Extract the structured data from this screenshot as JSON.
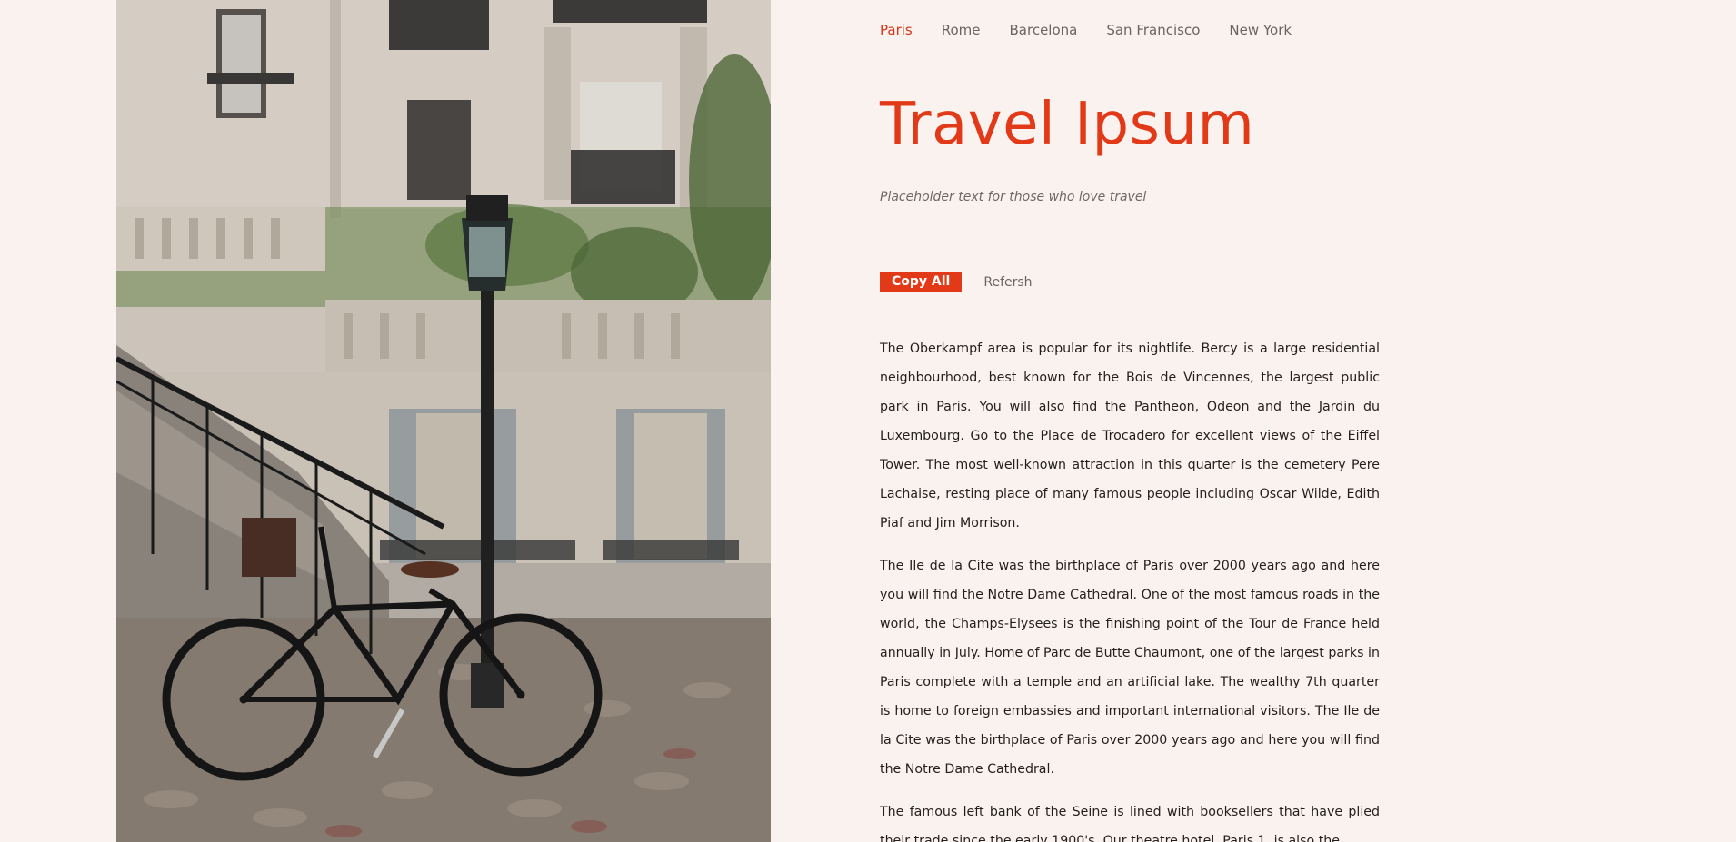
{
  "nav": {
    "cities": [
      {
        "label": "Paris",
        "active": true
      },
      {
        "label": "Rome",
        "active": false
      },
      {
        "label": "Barcelona",
        "active": false
      },
      {
        "label": "San Francisco",
        "active": false
      },
      {
        "label": "New York",
        "active": false
      }
    ]
  },
  "hero": {
    "title": "Travel Ipsum",
    "subtitle": "Placeholder text for those who love travel"
  },
  "actions": {
    "copy_label": "Copy All",
    "refresh_label": "Refersh"
  },
  "paragraphs": [
    "The Oberkampf area is popular for its nightlife. Bercy is a large residential neighbourhood, best known for the Bois de Vincennes, the largest public park in Paris. You will also find the Pantheon, Odeon and the Jardin du Luxembourg. Go to the Place de Trocadero for excellent views of the Eiffel Tower. The most well-known attraction in this quarter is the cemetery Pere Lachaise, resting place of many famous people including Oscar Wilde, Edith Piaf and Jim Morrison.",
    "The Ile de la Cite was the birthplace of Paris over 2000 years ago and here you will find the Notre Dame Cathedral. One of the most famous roads in the world, the Champs-Elysees is the finishing point of the Tour de France held annually in July. Home of Parc de Butte Chaumont, one of the largest parks in Paris complete with a temple and an artificial lake. The wealthy 7th quarter is home to foreign embassies and important international visitors. The Ile de la Cite was the birthplace of Paris over 2000 years ago and here you will find the Notre Dame Cathedral.",
    "The famous left bank of the Seine is lined with booksellers that have plied their trade since the early 1900's. Our theatre hotel, Paris 1, is also the"
  ],
  "theme": {
    "accent": "#e23a18",
    "background": "#f9f2ee",
    "body_text": "#221f1d",
    "muted_text": "#6b6460"
  },
  "photo": {
    "subject": "paris-street-bicycle-lamppost-photo"
  }
}
